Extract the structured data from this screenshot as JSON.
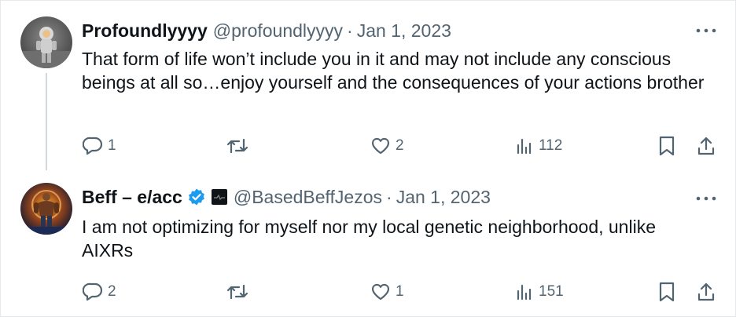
{
  "tweets": [
    {
      "name": "Profoundlyyyy",
      "handle": "@profoundlyyyy",
      "separator": "·",
      "date": "Jan 1, 2023",
      "text": "That form of life won’t include you in it and may not include any conscious beings at all so…enjoy yourself and the consequences of your actions brother",
      "replies": "1",
      "retweets": "",
      "likes": "2",
      "views": "112"
    },
    {
      "name": "Beff – e/acc",
      "handle": "@BasedBeffJezos",
      "separator": "·",
      "date": "Jan 1, 2023",
      "text": "I am not optimizing for myself nor my local genetic neighborhood, unlike AIXRs",
      "replies": "2",
      "retweets": "",
      "likes": "1",
      "views": "151"
    }
  ],
  "colors": {
    "verified": "#1d9bf0",
    "muted": "#536471",
    "text": "#0f1419",
    "thread": "#cfd9de"
  },
  "icons": [
    "reply-icon",
    "retweet-icon",
    "like-icon",
    "views-icon",
    "bookmark-icon",
    "share-icon",
    "more-icon",
    "verified-icon"
  ]
}
